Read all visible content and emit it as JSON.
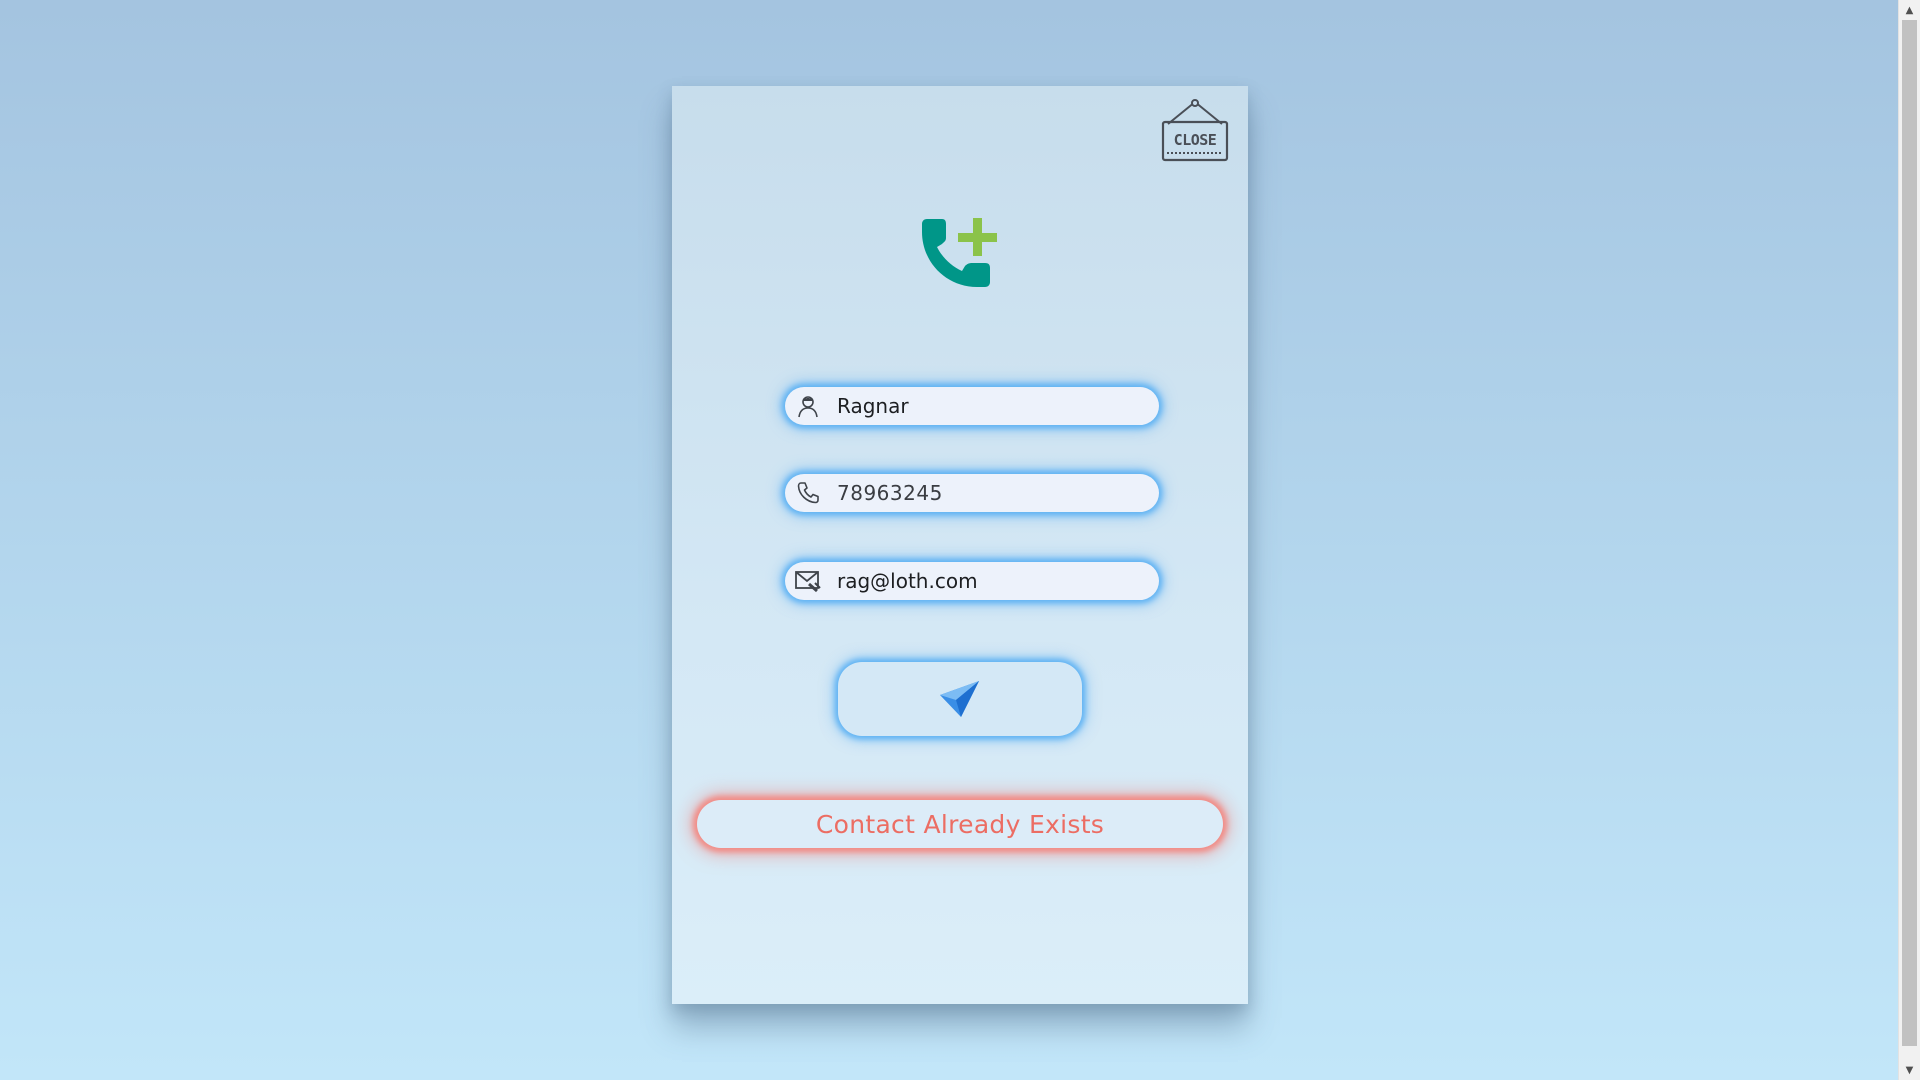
{
  "close_sign": {
    "label": "CLOSE"
  },
  "logo": {
    "icon": "phone-add-icon",
    "phone_color": "#009688",
    "plus_color": "#8bc34a"
  },
  "form": {
    "name": {
      "icon": "user-icon",
      "value": "Ragnar"
    },
    "phone": {
      "icon": "phone-icon",
      "value": "78963245"
    },
    "email": {
      "icon": "mail-icon",
      "value": "rag@loth.com"
    },
    "submit": {
      "icon": "paper-plane-icon"
    }
  },
  "message": {
    "text": "Contact Already Exists",
    "color": "#ec6d63"
  }
}
